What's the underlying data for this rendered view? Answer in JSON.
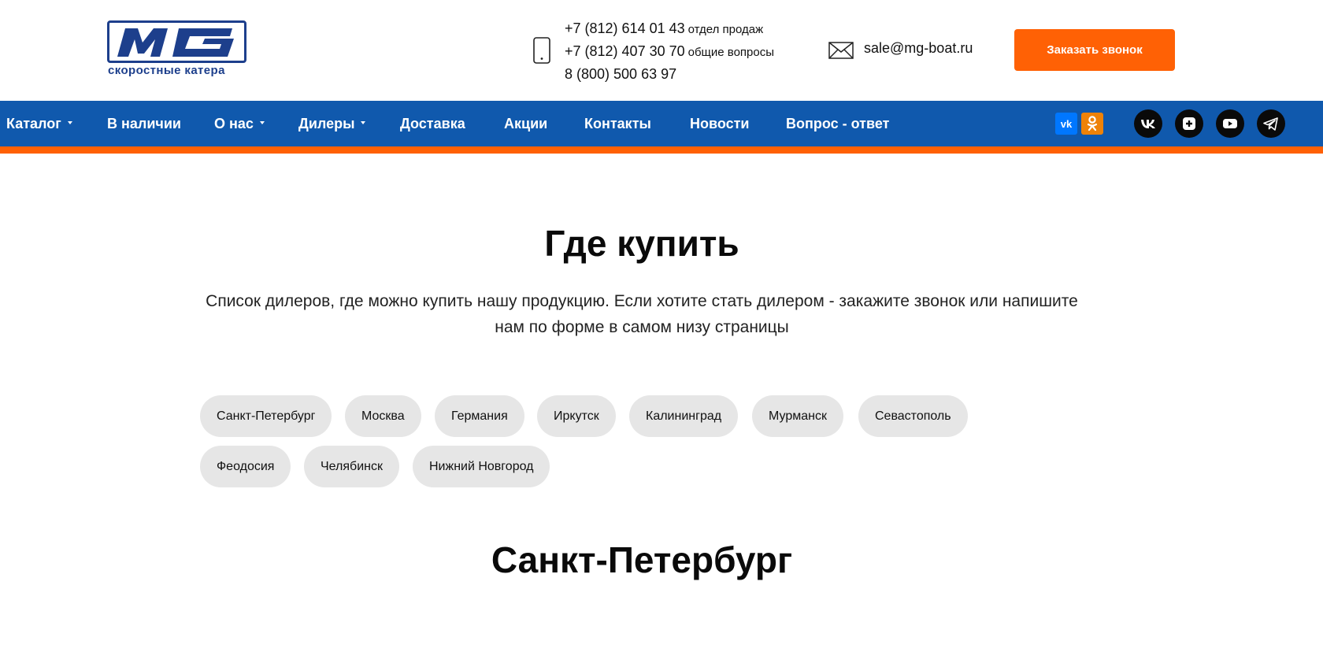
{
  "header": {
    "logo_text": "MG",
    "logo_subtitle": "скоростные катера",
    "phones": [
      {
        "number": "+7 (812) 614 01 43",
        "note": "отдел продаж"
      },
      {
        "number": "+7 (812) 407 30 70",
        "note": "общие вопросы"
      },
      {
        "number": "8 (800) 500 63 97",
        "note": ""
      }
    ],
    "email": "sale@mg-boat.ru",
    "cta_label": "Заказать звонок",
    "brand_blue": "#1d3f8c",
    "accent_orange": "#ff6105"
  },
  "nav": {
    "bar_color": "#1059ad",
    "items": [
      {
        "label": "Каталог",
        "has_dropdown": true
      },
      {
        "label": "В наличии",
        "has_dropdown": false
      },
      {
        "label": "О нас",
        "has_dropdown": true
      },
      {
        "label": "Дилеры",
        "has_dropdown": true
      },
      {
        "label": "Доставка",
        "has_dropdown": false
      },
      {
        "label": "Акции",
        "has_dropdown": false
      },
      {
        "label": "Контакты",
        "has_dropdown": false
      },
      {
        "label": "Новости",
        "has_dropdown": false
      },
      {
        "label": "Вопрос - ответ",
        "has_dropdown": false
      }
    ],
    "share_icons": [
      "vk-icon",
      "odnoklassniki-icon"
    ],
    "social_icons": [
      "vk-icon",
      "rutube-icon",
      "youtube-icon",
      "telegram-icon"
    ]
  },
  "main": {
    "title": "Где купить",
    "lead": "Список дилеров, где можно купить нашу продукцию. Если хотите стать дилером - закажите звонок или напишите нам по форме в самом низу страницы",
    "cities": [
      "Санкт-Петербург",
      "Москва",
      "Германия",
      "Иркутск",
      "Калининград",
      "Мурманск",
      "Севастополь",
      "Феодосия",
      "Челябинск",
      "Нижний Новгород"
    ],
    "section_title": "Санкт-Петербург"
  }
}
